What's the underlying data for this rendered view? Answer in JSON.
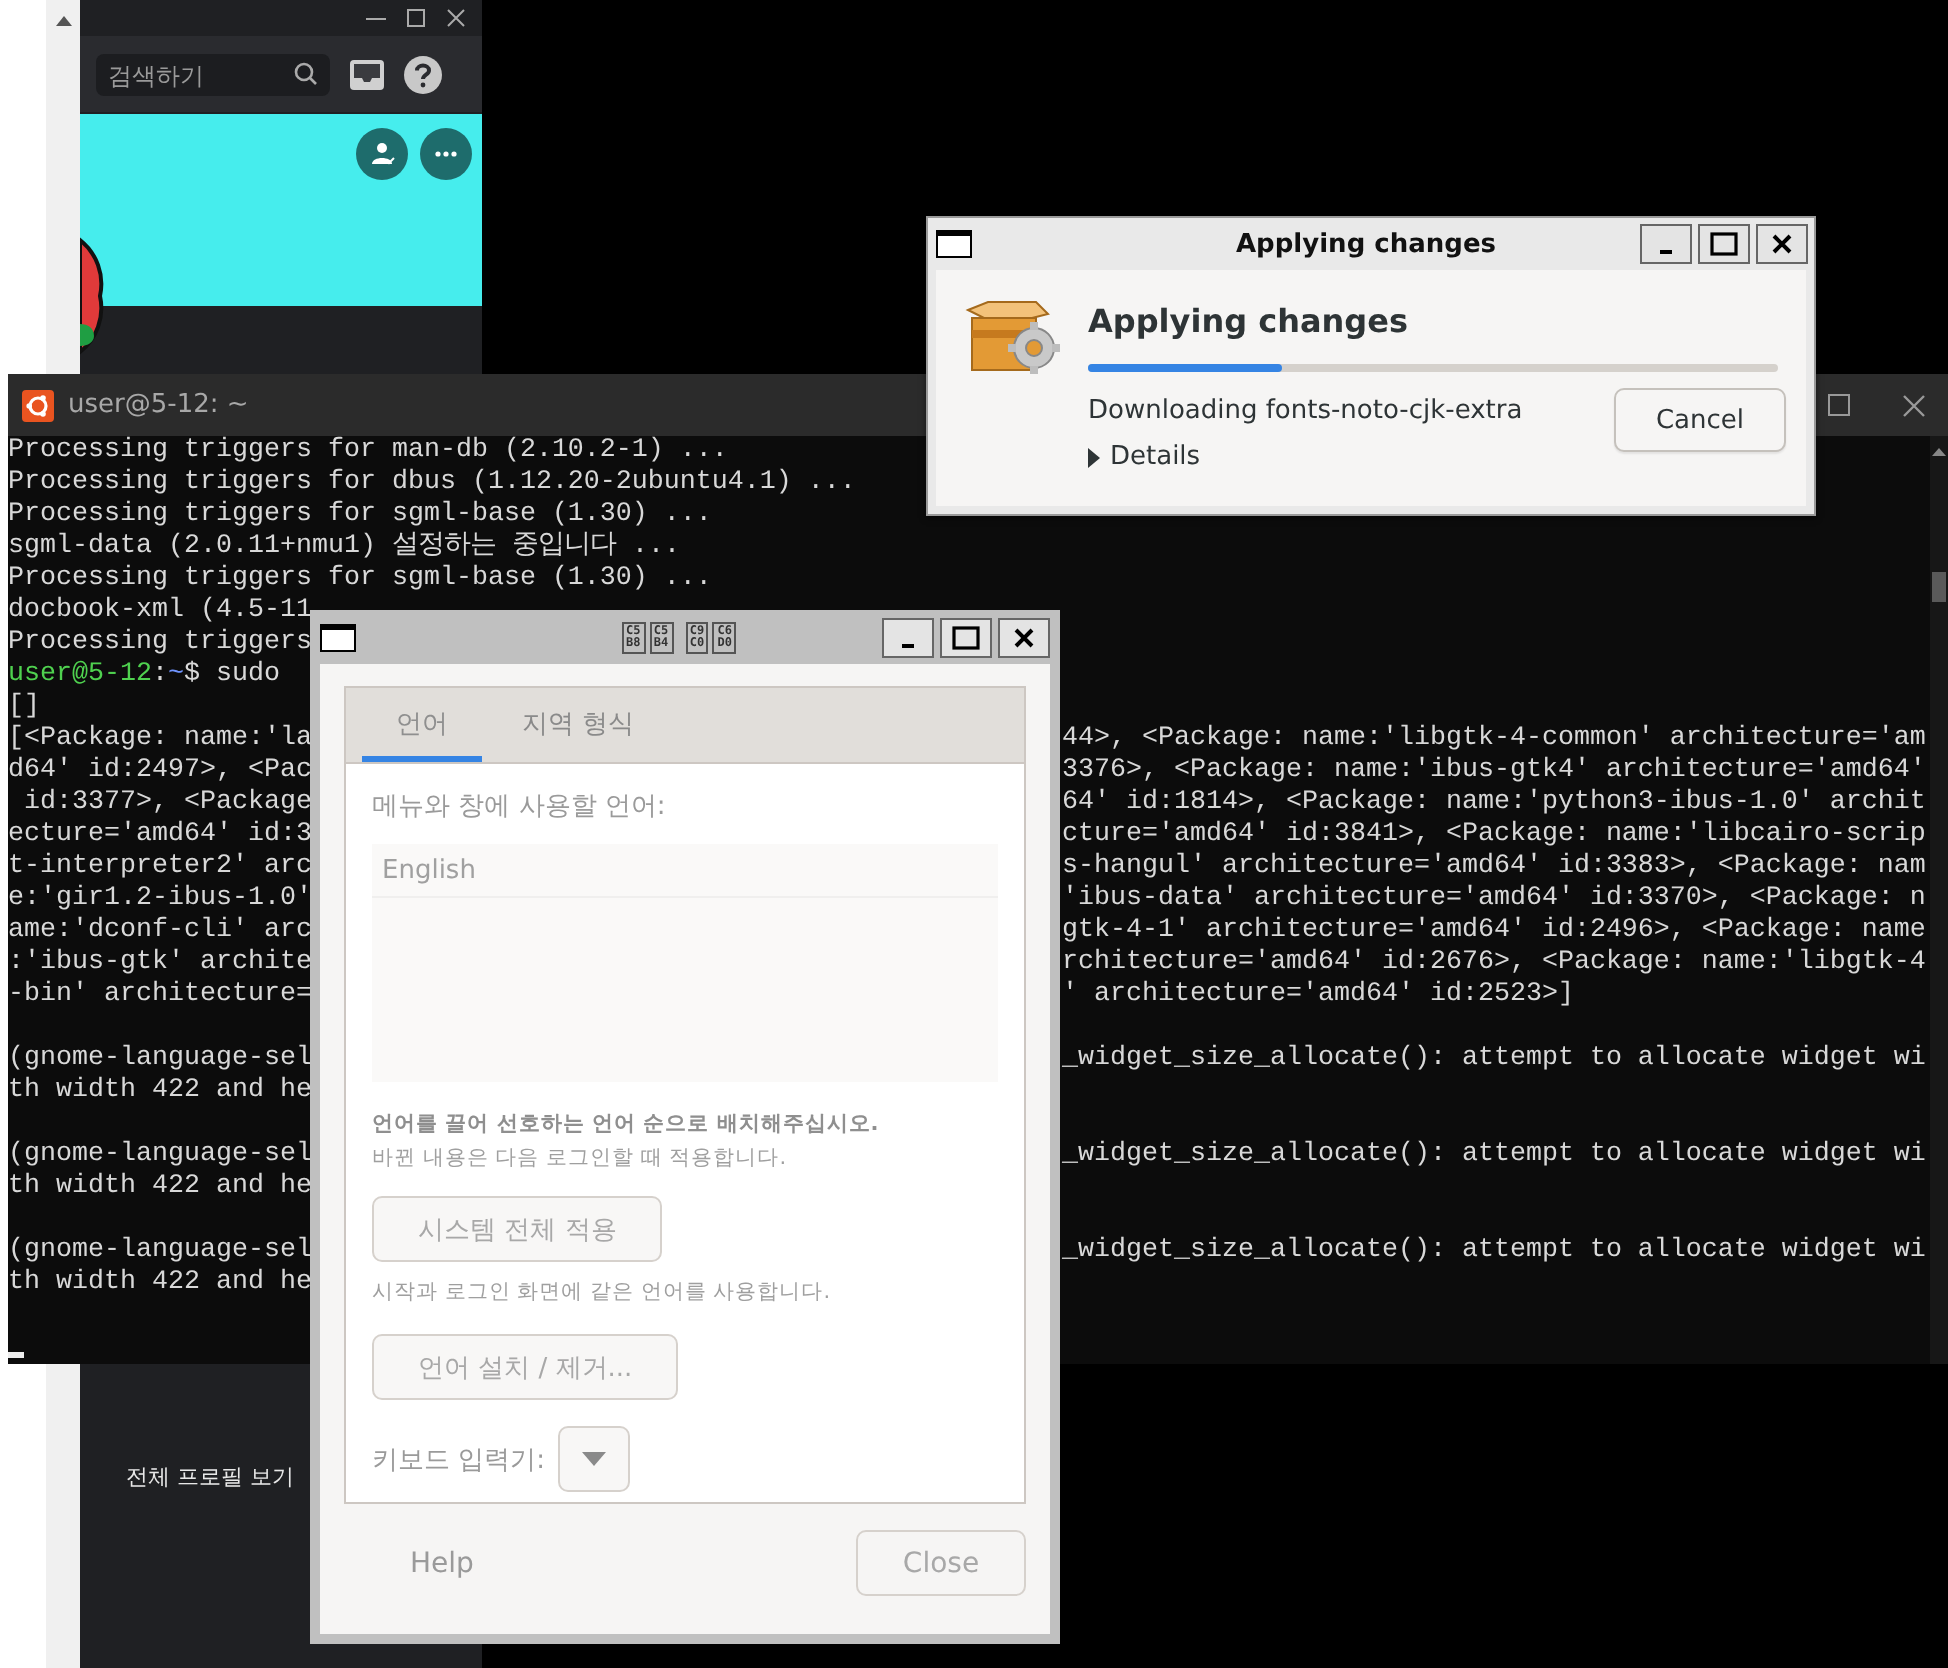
{
  "messenger": {
    "search": {
      "placeholder": "검색하기"
    },
    "profile_link": "전체 프로필 보기"
  },
  "terminal": {
    "title": "user@5-12: ~",
    "lines": [
      {
        "kind": "text",
        "left": "Processing triggers for man-db (2.10.2-1) ..."
      },
      {
        "kind": "text",
        "left": "Processing triggers for dbus (1.12.20-2ubuntu4.1) ..."
      },
      {
        "kind": "text",
        "left": "Processing triggers for sgml-base (1.30) ..."
      },
      {
        "kind": "text",
        "left": "sgml-data (2.0.11+nmu1) 설정하는 중입니다 ..."
      },
      {
        "kind": "text",
        "left": "Processing triggers for sgml-base (1.30) ..."
      },
      {
        "kind": "text",
        "left": "docbook-xml (4.5-11"
      },
      {
        "kind": "text",
        "left": "Processing triggers"
      },
      {
        "kind": "prompt",
        "segments": [
          {
            "text": "user@5-12",
            "color": "#4fd14f"
          },
          {
            "text": ":",
            "color": "#d8d8d8"
          },
          {
            "text": "~",
            "color": "#7094ff"
          },
          {
            "text": "$ sudo",
            "color": "#d8d8d8"
          }
        ]
      },
      {
        "kind": "text",
        "left": "[]"
      },
      {
        "kind": "text",
        "left": "[<Package: name:'la",
        "right": "44>, <Package: name:'libgtk-4-common' architecture='am"
      },
      {
        "kind": "text",
        "left": "d64' id:2497>, <Pac",
        "right": "3376>, <Package: name:'ibus-gtk4' architecture='amd64'"
      },
      {
        "kind": "text",
        "left": " id:3377>, <Package",
        "right": "64' id:1814>, <Package: name:'python3-ibus-1.0' archit"
      },
      {
        "kind": "text",
        "left": "ecture='amd64' id:3",
        "right": "cture='amd64' id:3841>, <Package: name:'libcairo-scrip"
      },
      {
        "kind": "text",
        "left": "t-interpreter2' arc",
        "right": "s-hangul' architecture='amd64' id:3383>, <Package: nam"
      },
      {
        "kind": "text",
        "left": "e:'gir1.2-ibus-1.0'",
        "right": "'ibus-data' architecture='amd64' id:3370>, <Package: n"
      },
      {
        "kind": "text",
        "left": "ame:'dconf-cli' arc",
        "right": "gtk-4-1' architecture='amd64' id:2496>, <Package: name"
      },
      {
        "kind": "text",
        "left": ":'ibus-gtk' archite",
        "right": "rchitecture='amd64' id:2676>, <Package: name:'libgtk-4"
      },
      {
        "kind": "text",
        "left": "-bin' architecture=",
        "right": "' architecture='amd64' id:2523>]"
      },
      {
        "kind": "blank"
      },
      {
        "kind": "text",
        "left": "(gnome-language-sel",
        "right": "_widget_size_allocate(): attempt to allocate widget wi"
      },
      {
        "kind": "text",
        "left": "th width 422 and he"
      },
      {
        "kind": "blank"
      },
      {
        "kind": "text",
        "left": "(gnome-language-sel",
        "right": "_widget_size_allocate(): attempt to allocate widget wi"
      },
      {
        "kind": "text",
        "left": "th width 422 and he"
      },
      {
        "kind": "blank"
      },
      {
        "kind": "text",
        "left": "(gnome-language-sel",
        "right": "_widget_size_allocate(): attempt to allocate widget wi"
      },
      {
        "kind": "text",
        "left": "th width 422 and he"
      },
      {
        "kind": "blank"
      },
      {
        "kind": "cursor"
      }
    ]
  },
  "progress_dialog": {
    "title": "Applying changes",
    "heading": "Applying changes",
    "level": 0.28,
    "status": "Downloading fonts-noto-cjk-extra",
    "details": {
      "label": "Details",
      "expanded": false
    },
    "buttons": [
      "Cancel"
    ]
  },
  "language_dialog": {
    "title_glyphs": [
      [
        "C5B8",
        "C5B4"
      ],
      [
        "C9C0",
        "C6D0"
      ]
    ],
    "tabs": [
      {
        "label": "언어",
        "selected": true
      },
      {
        "label": "지역 형식",
        "selected": false
      }
    ],
    "list_label": "메뉴와 창에 사용할 언어:",
    "languages": [
      {
        "name": "English",
        "disabled": true
      }
    ],
    "drag_hint": "언어를 끌어 선호하는 언어 순으로 배치해주십시오.",
    "apply_note": "바뀐 내용은 다음 로그인할 때 적용합니다.",
    "system_button": {
      "label": "시스템 전체 적용",
      "disabled": true
    },
    "system_note": "시작과 로그인 화면에 같은 언어를 사용합니다.",
    "install_button": {
      "label": "언어 설치 / 제거...",
      "disabled": true
    },
    "keyboard_label": "키보드 입력기:",
    "footer": {
      "help": "Help",
      "close": {
        "label": "Close",
        "disabled": true
      }
    }
  }
}
